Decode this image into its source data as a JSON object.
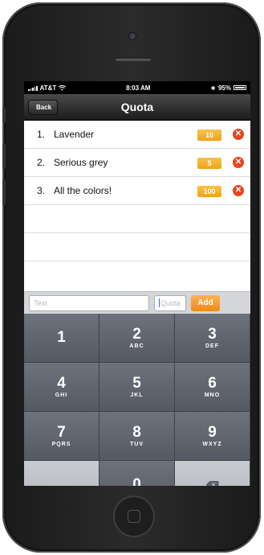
{
  "status_bar": {
    "carrier": "AT&T",
    "time": "8:03 AM",
    "battery": "95%"
  },
  "nav": {
    "title": "Quota",
    "back_label": "Back"
  },
  "items": [
    {
      "num": "1.",
      "name": "Lavender",
      "quota": "10"
    },
    {
      "num": "2.",
      "name": "Serious grey",
      "quota": "5"
    },
    {
      "num": "3.",
      "name": "All the colors!",
      "quota": "100"
    }
  ],
  "input_bar": {
    "text_placeholder": "Text",
    "quota_placeholder": "Quota",
    "add_label": "Add"
  },
  "keypad": [
    {
      "digit": "1",
      "letters": ""
    },
    {
      "digit": "2",
      "letters": "ABC"
    },
    {
      "digit": "3",
      "letters": "DEF"
    },
    {
      "digit": "4",
      "letters": "GHI"
    },
    {
      "digit": "5",
      "letters": "JKL"
    },
    {
      "digit": "6",
      "letters": "MNO"
    },
    {
      "digit": "7",
      "letters": "PQRS"
    },
    {
      "digit": "8",
      "letters": "TUV"
    },
    {
      "digit": "9",
      "letters": "WXYZ"
    },
    {
      "digit": "0",
      "letters": ""
    }
  ],
  "icons": {
    "delete_item": "close-circle-icon",
    "backspace": "backspace-icon",
    "wifi": "wifi-icon",
    "battery": "battery-icon",
    "signal": "signal-bars-icon"
  },
  "colors": {
    "accent": "#f08a12",
    "badge": "#f0a21a",
    "delete": "#e8451f"
  }
}
